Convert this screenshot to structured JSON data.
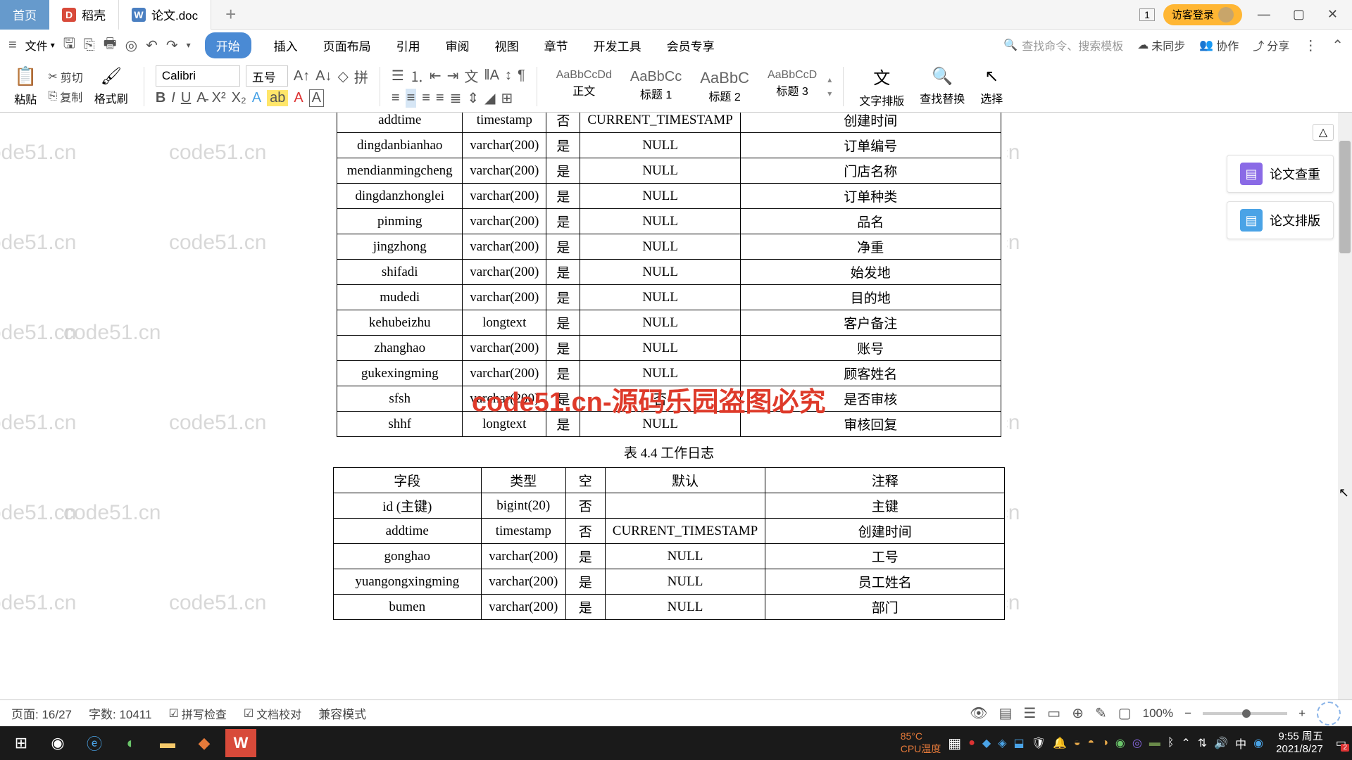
{
  "titleBar": {
    "homeTab": "首页",
    "daokeTab": "稻壳",
    "docTab": "论文.doc",
    "windowBadge": "1",
    "guestLogin": "访客登录"
  },
  "menuBar": {
    "fileLabel": "文件",
    "tabs": [
      "开始",
      "插入",
      "页面布局",
      "引用",
      "审阅",
      "视图",
      "章节",
      "开发工具",
      "会员专享"
    ],
    "searchPlaceholder": "查找命令、搜索模板",
    "unsync": "未同步",
    "collab": "协作",
    "share": "分享"
  },
  "ribbon": {
    "paste": "粘贴",
    "cut": "剪切",
    "copy": "复制",
    "formatBrush": "格式刷",
    "fontName": "Calibri",
    "fontSize": "五号",
    "styles": {
      "body": {
        "preview": "AaBbCcDd",
        "name": "正文"
      },
      "h1": {
        "preview": "AaBbCc",
        "name": "标题 1"
      },
      "h2": {
        "preview": "AaBbC",
        "name": "标题 2"
      },
      "h3": {
        "preview": "AaBbCcD",
        "name": "标题 3"
      }
    },
    "textLayout": "文字排版",
    "findReplace": "查找替换",
    "select": "选择"
  },
  "doc": {
    "table1": {
      "headerRow": [
        "addtime",
        "timestamp",
        "否",
        "CURRENT_TIMESTAMP",
        "创建时间"
      ],
      "rows": [
        [
          "dingdanbianhao",
          "varchar(200)",
          "是",
          "NULL",
          "订单编号"
        ],
        [
          "mendianmingcheng",
          "varchar(200)",
          "是",
          "NULL",
          "门店名称"
        ],
        [
          "dingdanzhonglei",
          "varchar(200)",
          "是",
          "NULL",
          "订单种类"
        ],
        [
          "pinming",
          "varchar(200)",
          "是",
          "NULL",
          "品名"
        ],
        [
          "jingzhong",
          "varchar(200)",
          "是",
          "NULL",
          "净重"
        ],
        [
          "shifadi",
          "varchar(200)",
          "是",
          "NULL",
          "始发地"
        ],
        [
          "mudedi",
          "varchar(200)",
          "是",
          "NULL",
          "目的地"
        ],
        [
          "kehubeizhu",
          "longtext",
          "是",
          "NULL",
          "客户备注"
        ],
        [
          "zhanghao",
          "varchar(200)",
          "是",
          "NULL",
          "账号"
        ],
        [
          "gukexingming",
          "varchar(200)",
          "是",
          "NULL",
          "顾客姓名"
        ],
        [
          "sfsh",
          "varchar(200)",
          "是",
          "否",
          "是否审核"
        ],
        [
          "shhf",
          "longtext",
          "是",
          "NULL",
          "审核回复"
        ]
      ]
    },
    "caption2": "表 4.4  工作日志",
    "table2": {
      "header": [
        "字段",
        "类型",
        "空",
        "默认",
        "注释"
      ],
      "rows": [
        [
          "id (主键)",
          "bigint(20)",
          "否",
          "",
          "主键"
        ],
        [
          "addtime",
          "timestamp",
          "否",
          "CURRENT_TIMESTAMP",
          "创建时间"
        ],
        [
          "gonghao",
          "varchar(200)",
          "是",
          "NULL",
          "工号"
        ],
        [
          "yuangongxingming",
          "varchar(200)",
          "是",
          "NULL",
          "员工姓名"
        ],
        [
          "bumen",
          "varchar(200)",
          "是",
          "NULL",
          "部门"
        ]
      ]
    },
    "watermarkText": "code51.cn",
    "overlayText": "code51.cn-源码乐园盗图必究"
  },
  "sidePanel": {
    "check": "论文查重",
    "layout": "论文排版"
  },
  "statusBar": {
    "page": "页面: 16/27",
    "words": "字数: 10411",
    "spellCheck": "拼写检查",
    "docProof": "文档校对",
    "compatMode": "兼容模式",
    "zoom": "100%"
  },
  "taskbar": {
    "cpu": "CPU温度",
    "temp": "85°C",
    "time": "9:55 周五",
    "date": "2021/8/27"
  }
}
